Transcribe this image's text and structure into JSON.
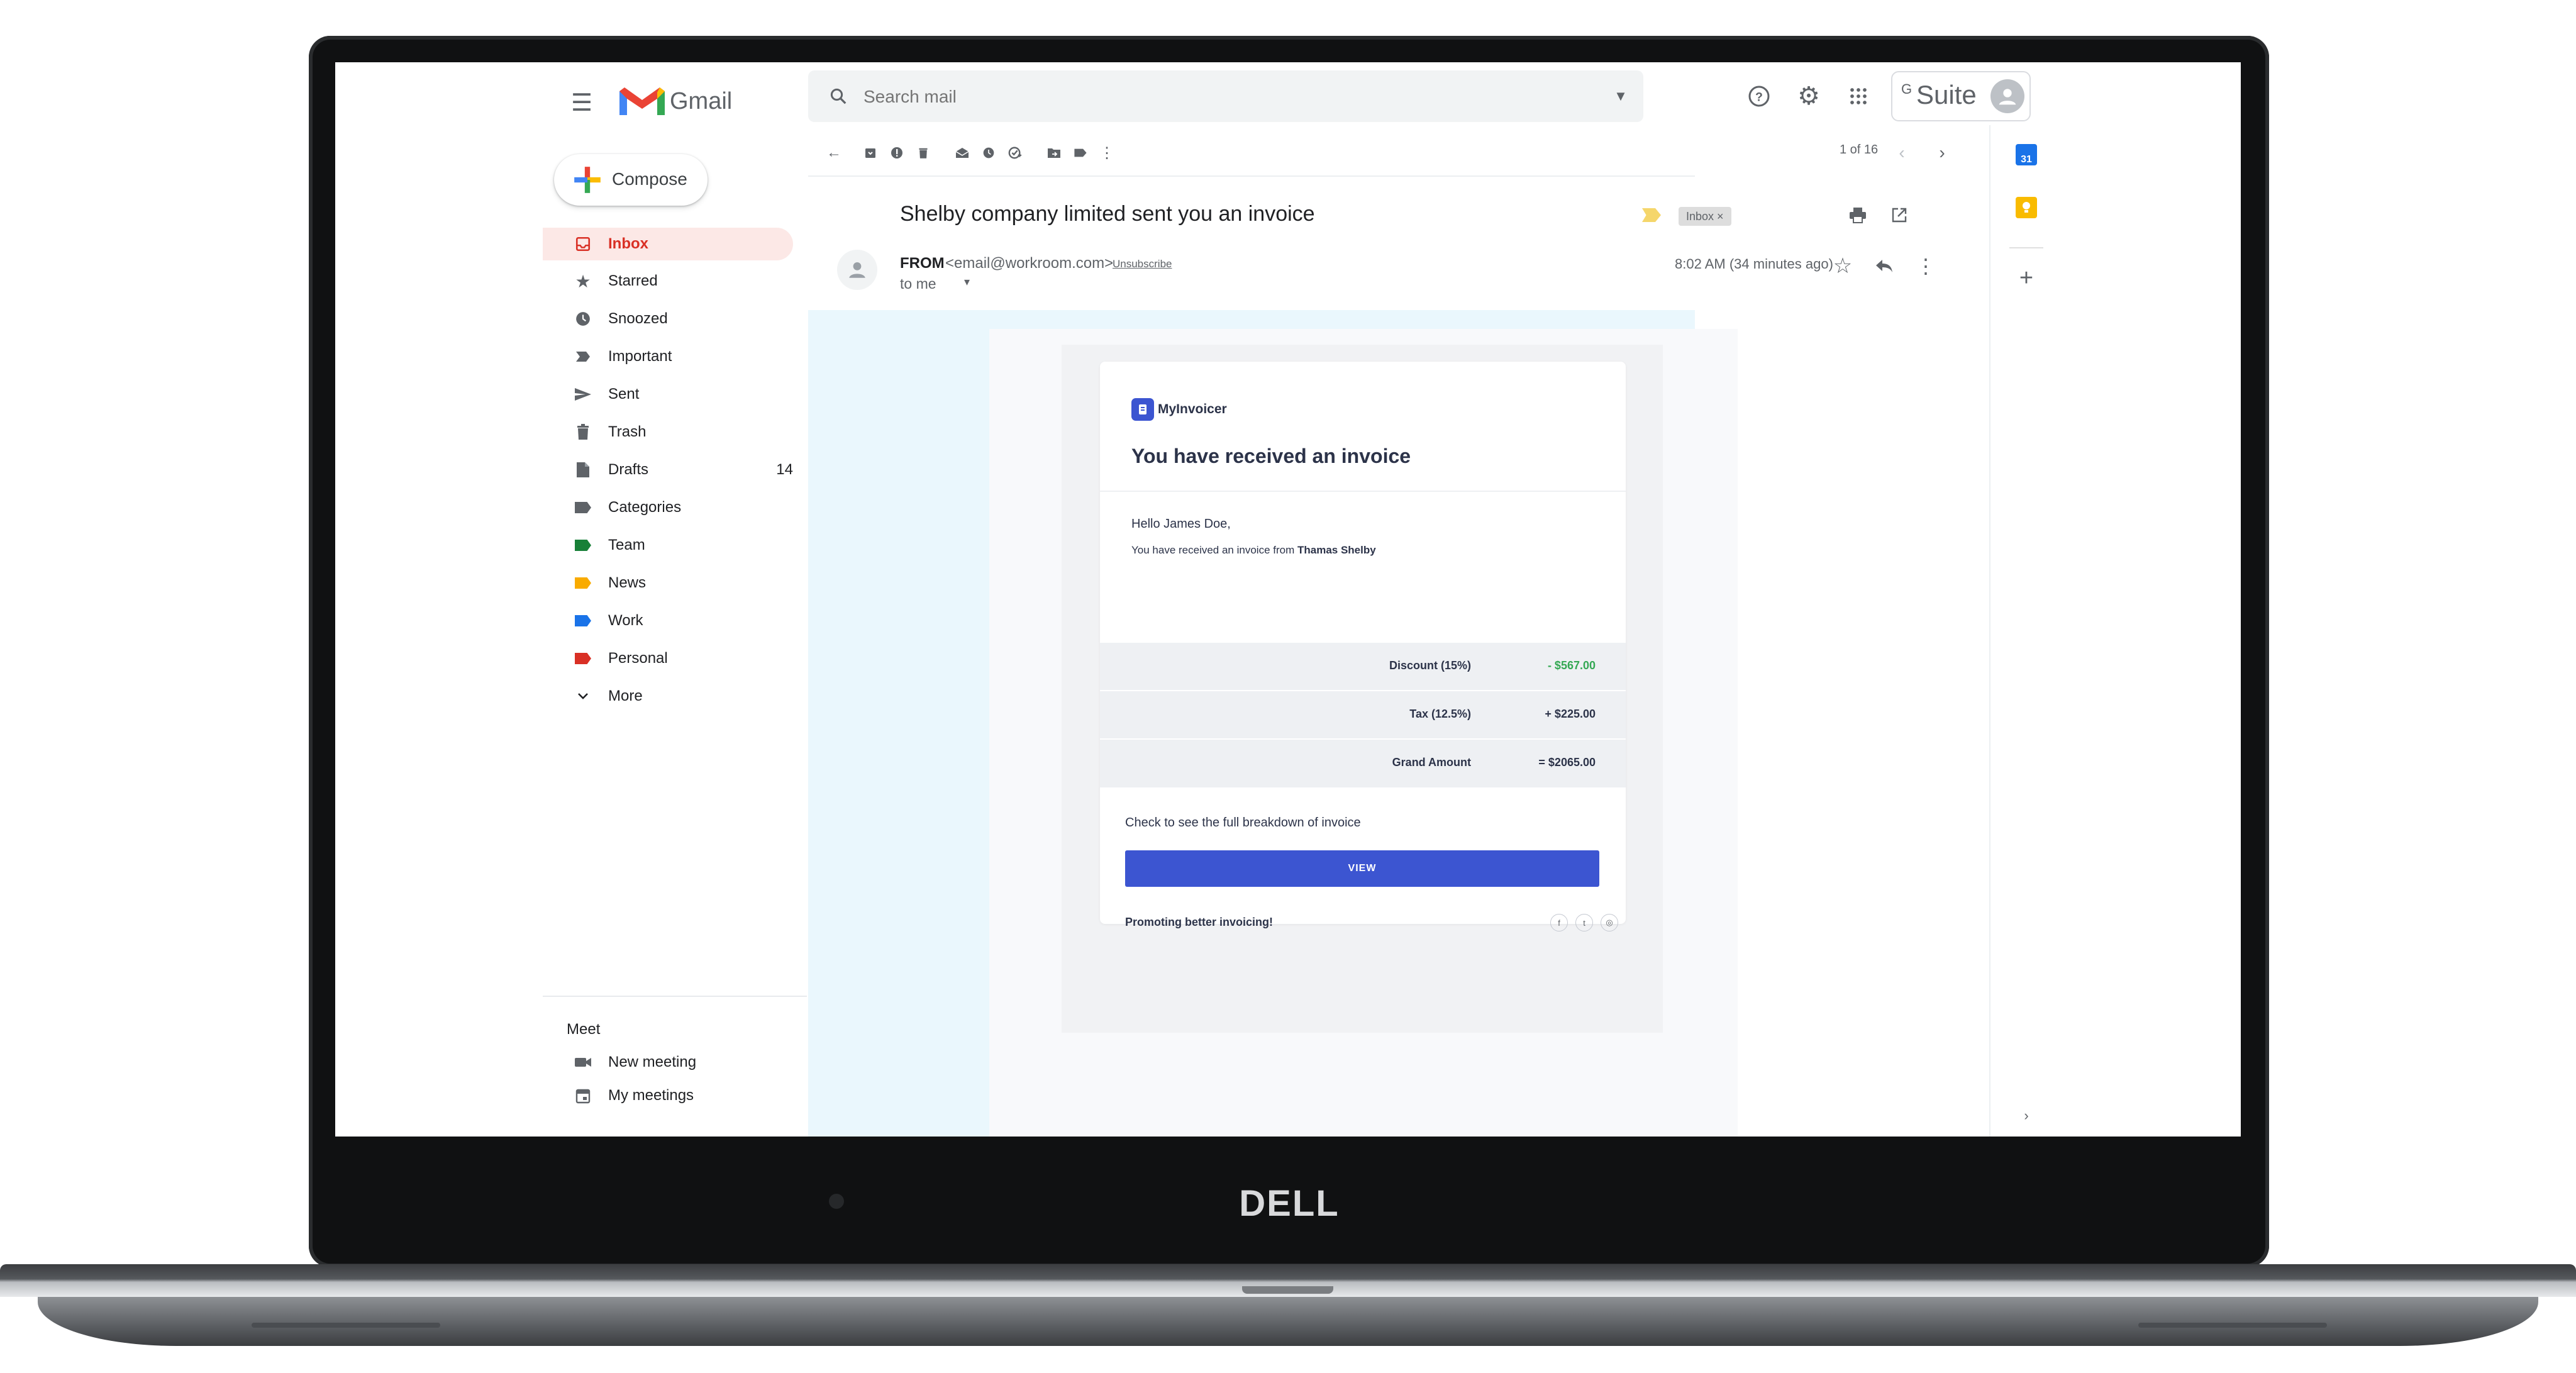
{
  "app": {
    "name": "Gmail",
    "gsuite_g": "G",
    "gsuite_label": "Suite",
    "brand_logo": "DELL"
  },
  "search": {
    "placeholder": "Search mail"
  },
  "compose": {
    "label": "Compose"
  },
  "sidebar": {
    "items": [
      {
        "label": "Inbox",
        "icon": "inbox-icon",
        "active": true
      },
      {
        "label": "Starred",
        "icon": "star-icon"
      },
      {
        "label": "Snoozed",
        "icon": "clock-icon"
      },
      {
        "label": "Important",
        "icon": "importance-icon"
      },
      {
        "label": "Sent",
        "icon": "send-icon"
      },
      {
        "label": "Trash",
        "icon": "trash-icon"
      },
      {
        "label": "Drafts",
        "icon": "draft-icon",
        "count": "14"
      },
      {
        "label": "Categories",
        "icon": "label-icon"
      },
      {
        "label": "Team",
        "icon": "label-icon",
        "color": "#188038"
      },
      {
        "label": "News",
        "icon": "label-icon",
        "color": "#f9ab00"
      },
      {
        "label": "Work",
        "icon": "label-icon",
        "color": "#1a73e8"
      },
      {
        "label": "Personal",
        "icon": "label-icon",
        "color": "#d93025"
      },
      {
        "label": "More",
        "icon": "chevron-down-icon"
      }
    ],
    "meet": {
      "heading": "Meet",
      "items": [
        {
          "label": "New meeting",
          "icon": "video-icon"
        },
        {
          "label": "My meetings",
          "icon": "calendar-icon"
        }
      ]
    }
  },
  "toolbar": {
    "pagination": "1 of 16",
    "icons": [
      "back-icon",
      "archive-icon",
      "report-spam-icon",
      "delete-icon",
      "mark-unread-icon",
      "snooze-icon",
      "add-to-tasks-icon",
      "move-to-icon",
      "label-icon",
      "more-vert-icon"
    ]
  },
  "email": {
    "subject": "Shelby company limited sent you an invoice",
    "inbox_chip": "Inbox ×",
    "from_name": "FROM",
    "from_email": "<email@workroom.com>",
    "unsubscribe": "Unsubscribe",
    "to": "to me",
    "time": "8:02 AM (34 minutes ago)"
  },
  "invoice": {
    "brand": "MyInvoicer",
    "heading": "You have received an invoice",
    "greeting": "Hello James Doe,",
    "from_prefix": "You have received an invoice from",
    "from_name": "Thamas Shelby",
    "rows": [
      {
        "label": "Discount (15%)",
        "value": "- $567.00",
        "color": "#34a853"
      },
      {
        "label": "Tax (12.5%)",
        "value": "+ $225.00",
        "color": "#2c3349"
      },
      {
        "label": "Grand Amount",
        "value": "= $2065.00",
        "color": "#2c3349"
      }
    ],
    "check_text": "Check to see the full breakdown of invoice",
    "view_label": "VIEW",
    "tagline": "Promoting better invoicing!",
    "social": [
      "f",
      "t",
      "◎"
    ]
  },
  "side_panel": {
    "calendar_day": "31"
  },
  "colors": {
    "accent": "#d93025",
    "invoice_blue": "#3c55d1",
    "active_bg": "#fce8e6"
  }
}
